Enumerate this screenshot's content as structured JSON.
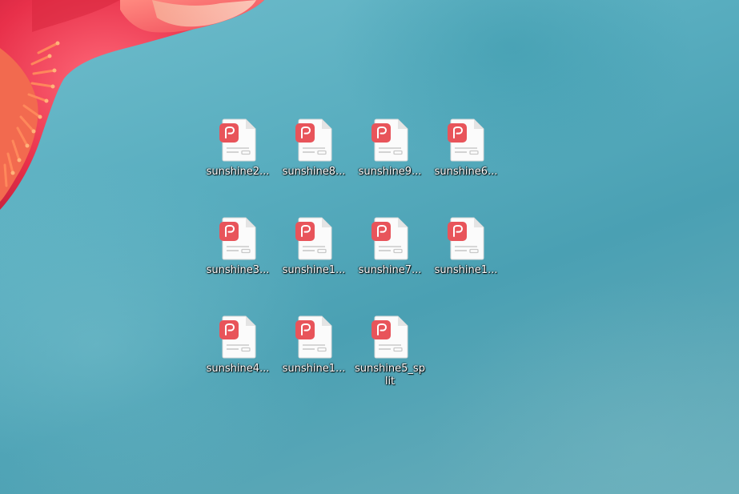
{
  "desktop": {
    "icons": [
      {
        "label": "sunshine2...",
        "icon": "wps-pdf-file-icon"
      },
      {
        "label": "sunshine8...",
        "icon": "wps-pdf-file-icon"
      },
      {
        "label": "sunshine9...",
        "icon": "wps-pdf-file-icon"
      },
      {
        "label": "sunshine6...",
        "icon": "wps-pdf-file-icon"
      },
      {
        "label": "sunshine3...",
        "icon": "wps-pdf-file-icon"
      },
      {
        "label": "sunshine1...",
        "icon": "wps-pdf-file-icon"
      },
      {
        "label": "sunshine7...",
        "icon": "wps-pdf-file-icon"
      },
      {
        "label": "sunshine1...",
        "icon": "wps-pdf-file-icon"
      },
      {
        "label": "sunshine4...",
        "icon": "wps-pdf-file-icon"
      },
      {
        "label": "sunshine1...",
        "icon": "wps-pdf-file-icon"
      },
      {
        "label": "sunshine5_split",
        "icon": "wps-pdf-file-icon"
      }
    ]
  },
  "colors": {
    "pdf_badge": "#e8545a",
    "wallpaper": "#58adbf",
    "flower": "#e83b4f"
  }
}
